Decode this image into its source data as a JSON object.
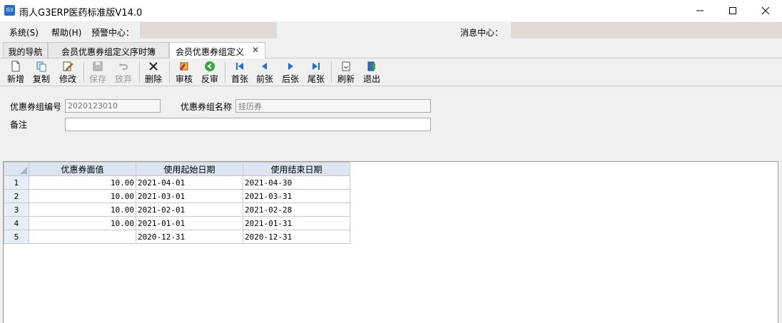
{
  "window": {
    "title": "雨人G3ERP医药标准版V14.0",
    "app_icon_text": "G3"
  },
  "menu": {
    "system": "系统(S)",
    "help": "帮助(H)",
    "alert_center": "预警中心：",
    "message_center": "消息中心："
  },
  "tabs": [
    {
      "label": "我的导航"
    },
    {
      "label": "会员优惠券组定义序时簿"
    },
    {
      "label": "会员优惠券组定义"
    }
  ],
  "toolbar": {
    "new": "新增",
    "copy": "复制",
    "edit": "修改",
    "save": "保存",
    "discard": "放弃",
    "delete": "删除",
    "approve": "审核",
    "unapprove": "反审",
    "first": "首张",
    "prev": "前张",
    "next": "后张",
    "last": "尾张",
    "refresh": "刷新",
    "exit": "退出"
  },
  "form": {
    "group_no_label": "优惠券组编号",
    "group_no_value": "2020123010",
    "group_name_label": "优惠券组名称",
    "group_name_value": "挂历券",
    "remark_label": "备注",
    "remark_value": ""
  },
  "grid": {
    "columns": [
      "优惠券面值",
      "使用起始日期",
      "使用结束日期"
    ],
    "rows": [
      {
        "no": "1",
        "value": "10.00",
        "start": "2021-04-01",
        "end": "2021-04-30"
      },
      {
        "no": "2",
        "value": "10.00",
        "start": "2021-03-01",
        "end": "2021-03-31"
      },
      {
        "no": "3",
        "value": "10.00",
        "start": "2021-02-01",
        "end": "2021-02-28"
      },
      {
        "no": "4",
        "value": "10.00",
        "start": "2021-01-01",
        "end": "2021-01-31"
      },
      {
        "no": "5",
        "value": "",
        "start": "2020-12-31",
        "end": "2020-12-31"
      }
    ]
  },
  "colors": {
    "accent": "#2b6cc4",
    "alert_bg": "#e2d9d9",
    "grid_header": "#dce6f3"
  }
}
